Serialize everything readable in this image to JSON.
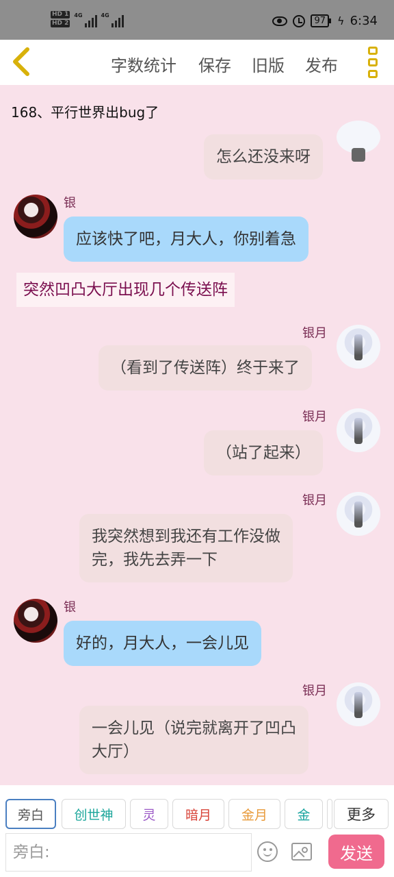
{
  "status_bar": {
    "left": {
      "hd1": "HD 1",
      "hd2": "HD 2",
      "net1": "4G",
      "net2": "4G"
    },
    "battery": "97",
    "time": "6:34",
    "icons": [
      "eye-icon",
      "alarm-icon",
      "battery-icon",
      "charging-icon"
    ]
  },
  "toolbar": {
    "back_icon": "chevron-left-icon",
    "word_count": "字数统计",
    "save": "保存",
    "old_version": "旧版",
    "publish": "发布",
    "menu_icon": "vertical-dots-icon",
    "accent_color": "#d8b10a"
  },
  "chapter_title": "168、平行世界出bug了",
  "messages": [
    {
      "side": "right",
      "speaker": "",
      "text": "怎么还没来呀"
    },
    {
      "side": "left",
      "speaker": "银",
      "text": "应该快了吧，月大人，你别着急"
    },
    {
      "side": "narration",
      "text": "突然凹凸大厅出现几个传送阵"
    },
    {
      "side": "right",
      "speaker": "银月",
      "text": "（看到了传送阵）终于来了"
    },
    {
      "side": "right",
      "speaker": "银月",
      "text": "（站了起来）"
    },
    {
      "side": "right",
      "speaker": "银月",
      "text_line1": "我突然想到我还有工作没做",
      "text_line2": "完，我先去弄一下"
    },
    {
      "side": "left",
      "speaker": "银",
      "text": "好的，月大人，一会儿见"
    },
    {
      "side": "right",
      "speaker": "银月",
      "text_line1": "一会儿见（说完就离开了凹凸",
      "text_line2": "大厅）"
    }
  ],
  "roles": [
    {
      "label": "旁白",
      "color": "#555555",
      "selected": true
    },
    {
      "label": "创世神",
      "color": "#1aa59a"
    },
    {
      "label": "灵",
      "color": "#9b59c6"
    },
    {
      "label": "暗月",
      "color": "#d8443a"
    },
    {
      "label": "金月",
      "color": "#e89a3a"
    },
    {
      "label": "金",
      "color": "#1aa5a0"
    }
  ],
  "more": "更多",
  "input": {
    "placeholder": "旁白:",
    "value": ""
  },
  "send": "发送",
  "colors": {
    "background": "#f9e1ea",
    "left_bubble": "#a9d9fb",
    "right_bubble": "#f2dfe0",
    "send": "#f06a8e",
    "narration_text": "#7a0e4e"
  }
}
